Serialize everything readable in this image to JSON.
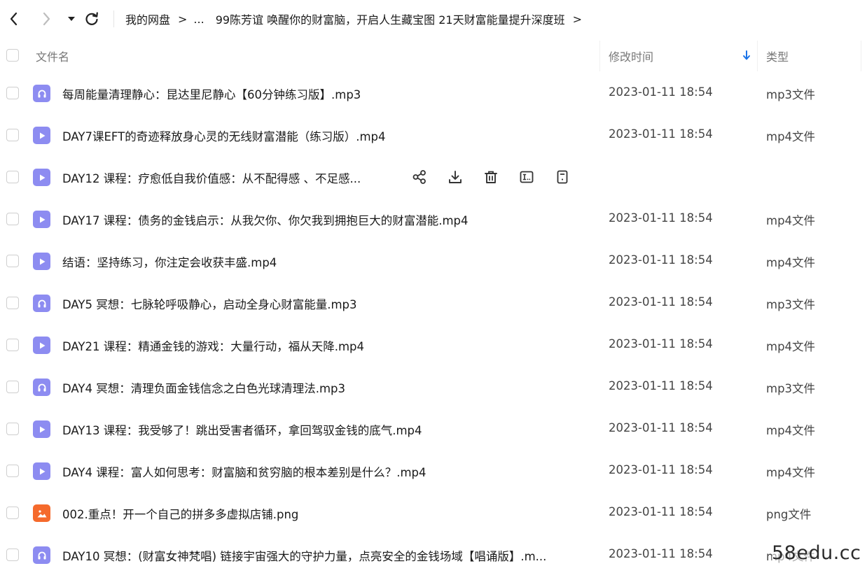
{
  "breadcrumb": {
    "root": "我的网盘",
    "ellipsis": "...",
    "current": "99陈芳谊 唤醒你的财富脑，开启人生藏宝图 21天财富能量提升深度班",
    "separator": ">"
  },
  "table": {
    "headers": {
      "name": "文件名",
      "modified": "修改时间",
      "type": "类型"
    },
    "rows": [
      {
        "name": "每周能量清理静心：昆达里尼静心【60分钟练习版】.mp3",
        "date": "2023-01-11 18:54",
        "type": "mp3文件",
        "icon": "audio-file-icon"
      },
      {
        "name": "DAY7课EFT的奇迹释放身心灵的无线财富潜能（练习版）.mp4",
        "date": "2023-01-11 18:54",
        "type": "mp4文件",
        "icon": "video-file-icon"
      },
      {
        "name": "DAY12 课程：疗愈低自我价值感：从不配得感 、不足感...",
        "date": "",
        "type": "",
        "icon": "video-file-icon"
      },
      {
        "name": "DAY17 课程：债务的金钱启示：从我欠你、你欠我到拥抱巨大的财富潜能.mp4",
        "date": "2023-01-11 18:54",
        "type": "mp4文件",
        "icon": "video-file-icon"
      },
      {
        "name": "结语：坚持练习，你注定会收获丰盛.mp4",
        "date": "2023-01-11 18:54",
        "type": "mp4文件",
        "icon": "video-file-icon"
      },
      {
        "name": "DAY5 冥想：七脉轮呼吸静心，启动全身心财富能量.mp3",
        "date": "2023-01-11 18:54",
        "type": "mp3文件",
        "icon": "audio-file-icon"
      },
      {
        "name": "DAY21 课程：精通金钱的游戏：大量行动，福从天降.mp4",
        "date": "2023-01-11 18:54",
        "type": "mp4文件",
        "icon": "video-file-icon"
      },
      {
        "name": "DAY4 冥想：清理负面金钱信念之白色光球清理法.mp3",
        "date": "2023-01-11 18:54",
        "type": "mp3文件",
        "icon": "audio-file-icon"
      },
      {
        "name": "DAY13 课程：我受够了！跳出受害者循环，拿回驾驭金钱的底气.mp4",
        "date": "2023-01-11 18:54",
        "type": "mp4文件",
        "icon": "video-file-icon"
      },
      {
        "name": "DAY4 课程：富人如何思考：财富脑和贫穷脑的根本差别是什么？.mp4",
        "date": "2023-01-11 18:54",
        "type": "mp4文件",
        "icon": "video-file-icon"
      },
      {
        "name": "002.重点！开一个自己的拼多多虚拟店铺.png",
        "date": "2023-01-11 18:54",
        "type": "png文件",
        "icon": "image-file-icon"
      },
      {
        "name": "DAY10 冥想：(财富女神梵唱) 链接宇宙强大的守护力量，点亮安全的金钱场域【唱诵版】.m...",
        "date": "2023-01-11 18:54",
        "type": "mp4文件",
        "icon": "audio-file-icon"
      }
    ]
  },
  "hover_actions": [
    "share-icon",
    "download-icon",
    "delete-icon",
    "rename-icon",
    "details-icon"
  ],
  "watermark": "58edu.cc",
  "colors": {
    "video_icon": "#8d8cf1",
    "audio_icon": "#8d8cf1",
    "image_icon": "#f56a2c",
    "sort_arrow": "#1a73e8"
  }
}
